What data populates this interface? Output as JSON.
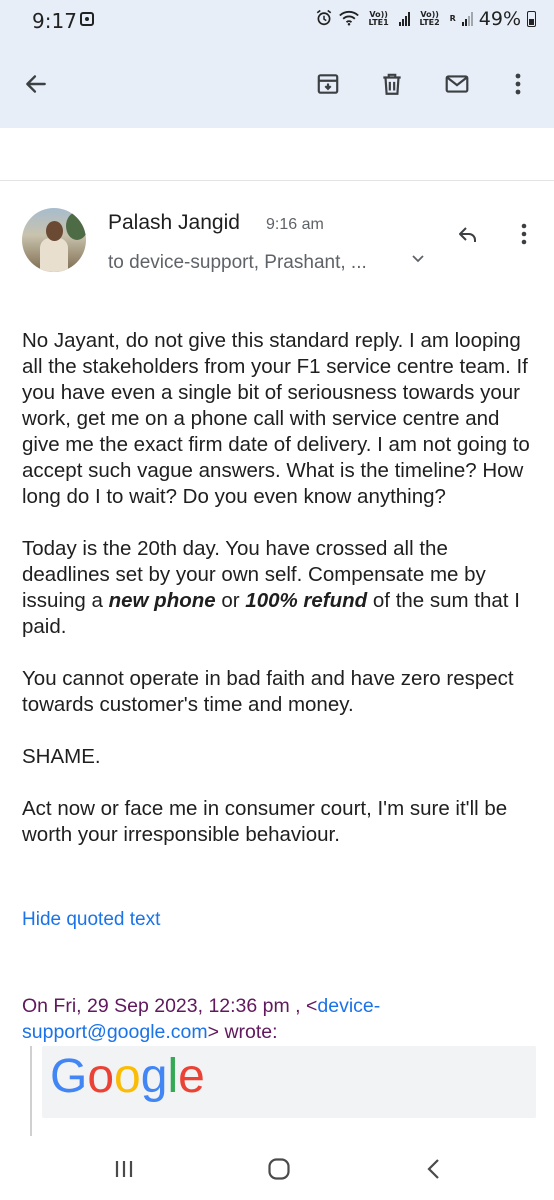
{
  "status_bar": {
    "time": "9:17",
    "net1_label": "Vo)) LTE1",
    "net2_label": "Vo)) LTE2",
    "roaming": "R",
    "battery": "49%"
  },
  "toolbar": {
    "back_icon": "arrow-back-icon",
    "archive_icon": "archive-icon",
    "delete_icon": "delete-icon",
    "mark_unread_icon": "mail-icon",
    "more_icon": "more-vert-icon"
  },
  "message": {
    "sender": "Palash Jangid",
    "time": "9:16 am",
    "recipients": "to device-support, Prashant, ...",
    "body": {
      "p1": "No Jayant, do not give this standard reply. I am looping all the stakeholders from your F1 service centre team. If you have even a single bit of seriousness towards your work, get me on a phone call with service centre and give me the exact firm date of delivery. I am not going to accept such vague answers. What is the timeline? How long do I to wait? Do you even know anything?",
      "p2_a": "Today is the 20th day. You have crossed all the deadlines set by your own self. Compensate me by issuing a ",
      "p2_b": "new phone",
      "p2_c": " or ",
      "p2_d": "100% refund",
      "p2_e": " of the sum that I paid.",
      "p3": "You cannot operate in bad faith and have zero respect towards customer's time and money.",
      "p4": "SHAME.",
      "p5": "Act now or face me in consumer court, I'm sure it'll be worth your irresponsible behaviour."
    },
    "hide_quoted": "Hide quoted text",
    "quote_prefix": "On Fri, 29 Sep 2023, 12:36 pm , <",
    "quote_email": "device-support@google.com",
    "quote_suffix": "> wrote:",
    "quoted_logo_text": "Google"
  },
  "colors": {
    "app_bar": "#e7eef8",
    "link": "#1a73e8",
    "attribution": "#60195c"
  }
}
